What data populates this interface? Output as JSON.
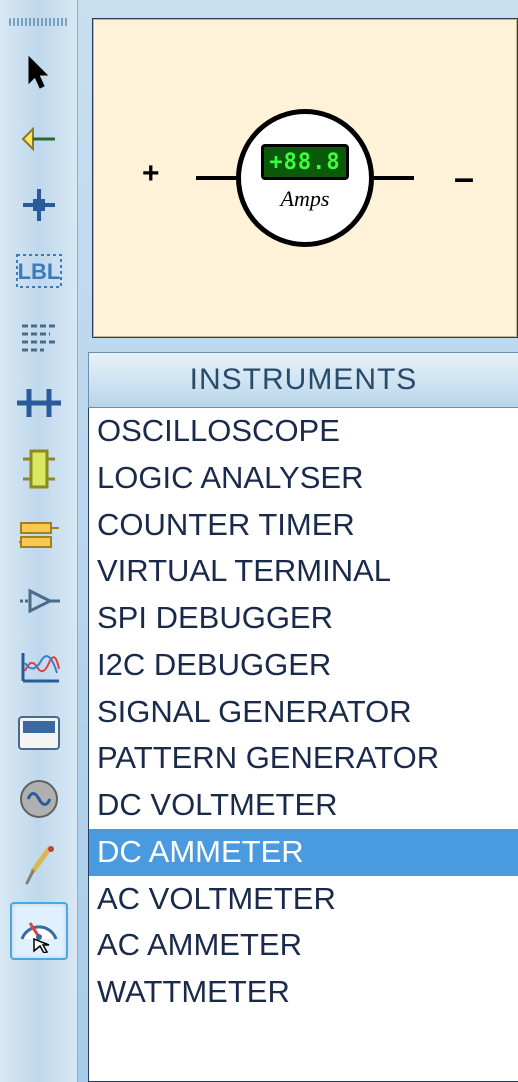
{
  "toolbar": {
    "tools": [
      {
        "name": "pointer-icon"
      },
      {
        "name": "component-icon"
      },
      {
        "name": "junction-icon"
      },
      {
        "name": "label-icon"
      },
      {
        "name": "text-script-icon"
      },
      {
        "name": "bus-icon"
      },
      {
        "name": "subcircuit-icon"
      },
      {
        "name": "terminal-icon"
      },
      {
        "name": "device-pin-icon"
      },
      {
        "name": "graph-icon"
      },
      {
        "name": "tape-recorder-icon"
      },
      {
        "name": "generator-icon"
      },
      {
        "name": "voltage-probe-icon"
      },
      {
        "name": "virtual-instruments-icon"
      }
    ],
    "selected_index": 13
  },
  "preview": {
    "plus": "+",
    "minus": "–",
    "reading": "+88.8",
    "unit": "Amps"
  },
  "panel": {
    "title": "INSTRUMENTS",
    "items": [
      "OSCILLOSCOPE",
      "LOGIC ANALYSER",
      "COUNTER TIMER",
      "VIRTUAL TERMINAL",
      "SPI DEBUGGER",
      "I2C DEBUGGER",
      "SIGNAL GENERATOR",
      "PATTERN GENERATOR",
      "DC VOLTMETER",
      "DC AMMETER",
      "AC VOLTMETER",
      "AC AMMETER",
      "WATTMETER"
    ],
    "selected_index": 9
  }
}
